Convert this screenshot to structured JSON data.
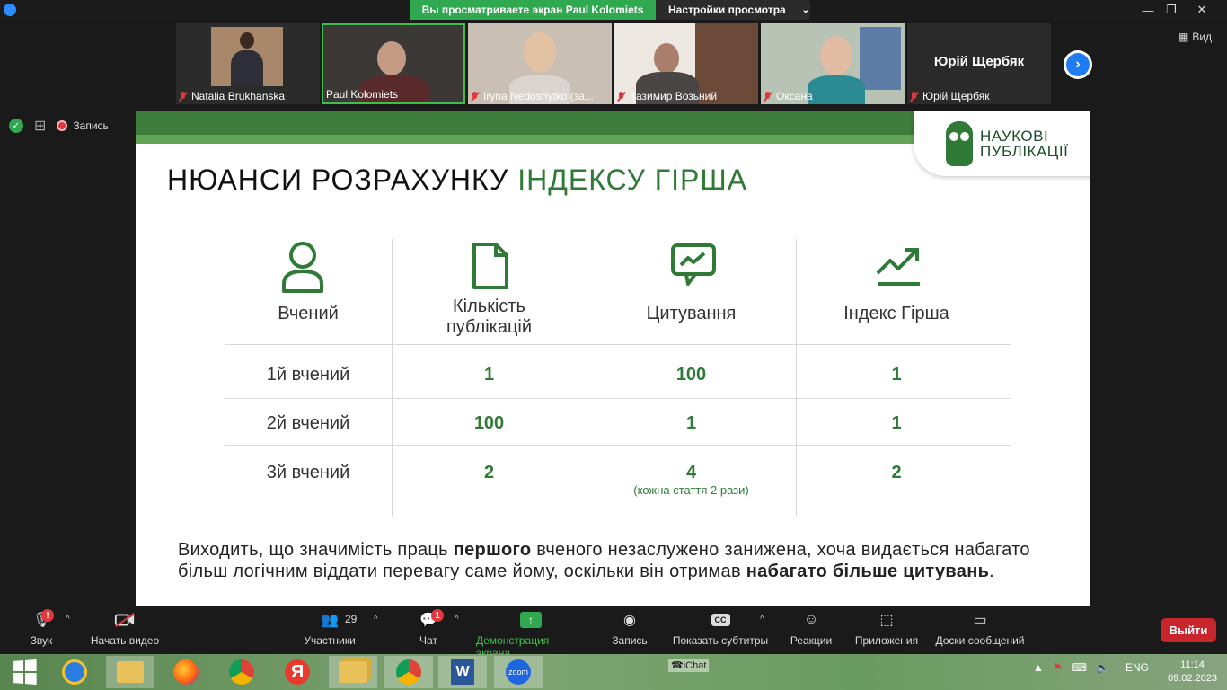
{
  "titlebar": {
    "share_banner": "Вы просматриваете экран Paul Kolomiets",
    "view_settings": "Настройки просмотра",
    "minimize": "—",
    "restore": "❐",
    "close": "✕"
  },
  "participants_strip": {
    "tiles": [
      {
        "name": "Natalia Brukhanska",
        "muted": true
      },
      {
        "name": "Paul Kolomiets",
        "muted": false
      },
      {
        "name": "Iryna Nedoshytko (за...",
        "muted": true
      },
      {
        "name": "Казимир Возьний",
        "muted": true
      },
      {
        "name": "Оксана",
        "muted": true
      },
      {
        "name": "Юрій Щербяк",
        "muted": true
      }
    ],
    "large_name": "Юрій Щербяк",
    "view_label": "Вид"
  },
  "status": {
    "record_label": "Запись"
  },
  "slide": {
    "logo_line1": "НАУКОВІ",
    "logo_line2": "ПУБЛІКАЦІЇ",
    "title_plain": "НЮАНСИ РОЗРАХУНКУ ",
    "title_accent": "ІНДЕКСУ ГІРША",
    "columns": [
      "Вчений",
      "Кількість публікацій",
      "Цитування",
      "Індекс Гірша"
    ],
    "columns_lines": {
      "pubs_line1": "Кількість",
      "pubs_line2": "публікацій"
    },
    "rows": [
      {
        "scientist": "1й вчений",
        "publications": "1",
        "citations": "100",
        "h_index": "1"
      },
      {
        "scientist": "2й вчений",
        "publications": "100",
        "citations": "1",
        "h_index": "1"
      },
      {
        "scientist": "3й вчений",
        "publications": "2",
        "citations": "4",
        "citations_note": "(кожна стаття 2 рази)",
        "h_index": "2"
      }
    ],
    "conclusion": {
      "p1": "Виходить, що значимість праць ",
      "b1": "першого",
      "p2": " вченого незаслужено занижена, хоча видається набагато більш логічним віддати перевагу саме йому, оскільки він отримав ",
      "b2": "набагато більше цитувань",
      "p3": "."
    }
  },
  "toolbar": {
    "audio": "Звук",
    "audio_badge": "!",
    "video": "Начать видео",
    "participants": "Участники",
    "participants_count": "29",
    "chat": "Чат",
    "chat_badge": "1",
    "share": "Демонстрация экрана",
    "record": "Запись",
    "captions": "Показать субтитры",
    "captions_icon": "CC",
    "reactions": "Реакции",
    "apps": "Приложения",
    "whiteboards": "Доски сообщений",
    "leave": "Выйти"
  },
  "taskbar": {
    "ichat": "iChat",
    "lang": "ENG",
    "time": "11:14",
    "date": "09.02.2023",
    "zoom_label": "zoom"
  },
  "colors": {
    "accent_green": "#2f7a37",
    "share_banner": "#2fa84f",
    "leave_red": "#c8252c",
    "zoom_blue": "#2d8cff"
  }
}
